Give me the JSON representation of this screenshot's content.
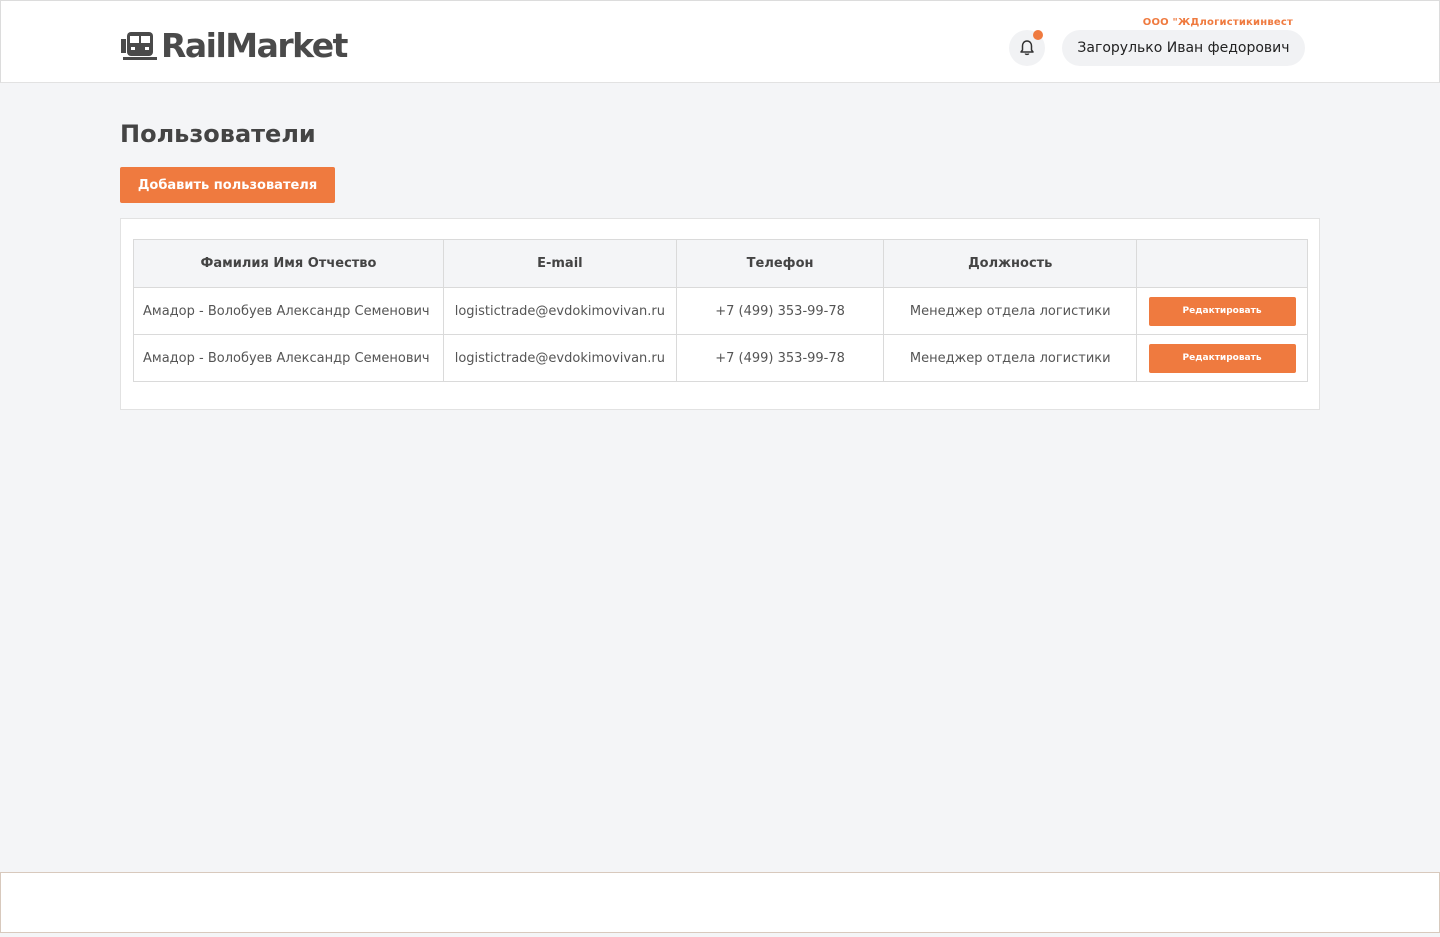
{
  "header": {
    "logo_text": "RailMarket",
    "company": "ООО \"ЖДлогистикинвест",
    "user_name": "Загорулько Иван федорович",
    "notification_icon": "bell-icon",
    "has_notification": true
  },
  "main": {
    "title": "Пользователи",
    "add_button": "Добавить пользователя"
  },
  "table": {
    "columns": [
      "Фамилия Имя Отчество",
      "E-mail",
      "Телефон",
      "Должность",
      ""
    ],
    "rows": [
      {
        "name": "Амадор - Волобуев Александр Семенович",
        "email": "logistictrade@evdokimovivan.ru",
        "phone": "+7 (499) 353-99-78",
        "position": "Менеджер отдела логистики",
        "action": "Редактировать"
      },
      {
        "name": "Амадор - Волобуев Александр Семенович",
        "email": "logistictrade@evdokimovivan.ru",
        "phone": "+7 (499) 353-99-78",
        "position": "Менеджер отдела логистики",
        "action": "Редактировать"
      }
    ]
  },
  "colors": {
    "accent": "#ef7a3f",
    "background": "#f4f5f7",
    "text_dark": "#444444"
  }
}
